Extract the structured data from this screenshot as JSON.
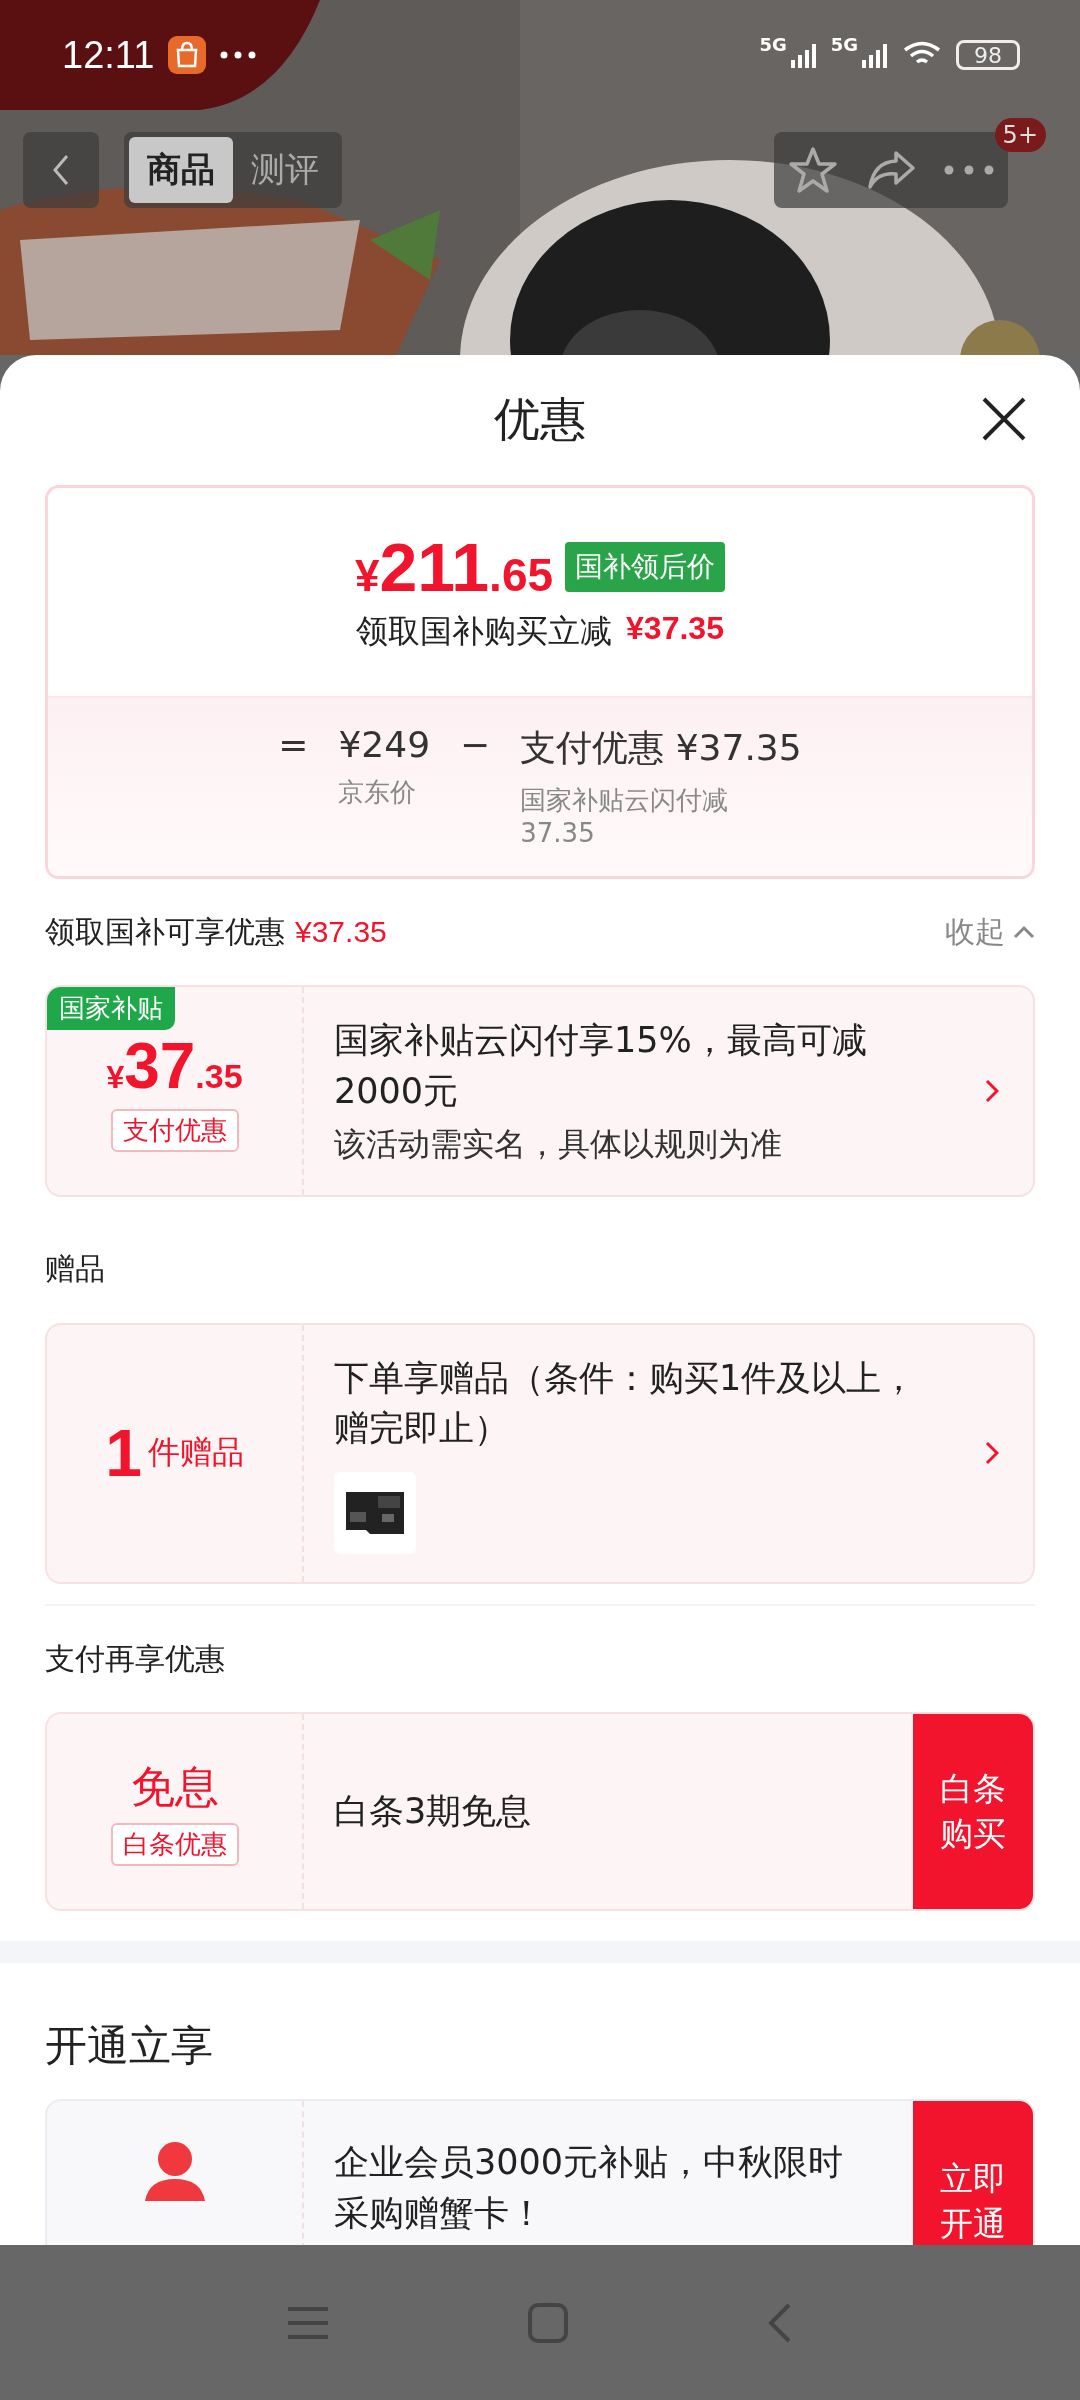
{
  "status_bar": {
    "time": "12:11",
    "network_1": "5G",
    "network_2": "5G",
    "battery": "98"
  },
  "header": {
    "tabs": [
      {
        "label": "商品",
        "selected": true
      },
      {
        "label": "测评",
        "selected": false
      }
    ],
    "badge": "5+"
  },
  "sheet": {
    "title": "优惠",
    "price_card": {
      "currency": "¥",
      "price_int": "211",
      "price_dec": ".65",
      "price_tag": "国补领后价",
      "saving_label": "领取国补购买立减",
      "saving_value": "¥37.35",
      "equals": "=",
      "base_value": "¥249",
      "base_label": "京东价",
      "minus": "−",
      "discount_value": "支付优惠 ¥37.35",
      "discount_label": "国家补贴云闪付减37.35"
    },
    "sections": [
      {
        "kind": "sub",
        "heading": "领取国补可享优惠",
        "heading_value": "¥37.35",
        "toggle": "收起",
        "expanded": true,
        "cards": [
          {
            "kind": "amount",
            "corner_tag": "国家补贴",
            "currency": "¥",
            "amount_int": "37",
            "amount_dec": ".35",
            "label": "支付优惠",
            "title": "国家补贴云闪付享15%，最高可减2000元",
            "note": "该活动需实名，具体以规则为准"
          }
        ]
      },
      {
        "kind": "sub",
        "heading": "赠品",
        "cards": [
          {
            "kind": "gift",
            "count": "1",
            "unit": "件赠品",
            "title": "下单享赠品（条件：购买1件及以上，赠完即止）"
          }
        ]
      },
      {
        "kind": "sub",
        "heading": "支付再享优惠",
        "cards": [
          {
            "kind": "text",
            "amount": "免息",
            "label": "白条优惠",
            "title": "白条3期免息",
            "button": "白条购买"
          }
        ]
      },
      {
        "kind": "main",
        "heading": "开通立享",
        "cards": [
          {
            "kind": "member",
            "title": "企业会员3000元补贴，中秋限时采购赠蟹卡！",
            "button": "立即开通"
          }
        ]
      }
    ]
  }
}
